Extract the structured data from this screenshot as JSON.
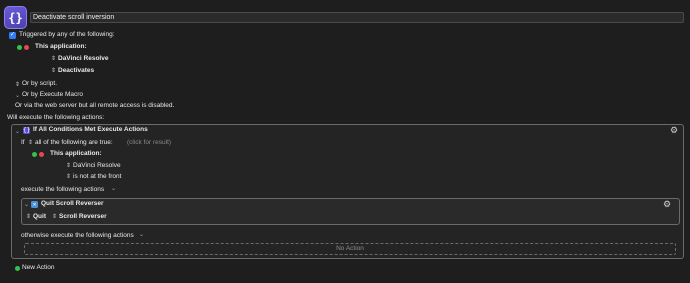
{
  "macro": {
    "name": "Deactivate scroll inversion"
  },
  "trigger": {
    "checkbox_label": "Triggered by any of the following:",
    "application_label": "This application:",
    "app_name": "DaVinci Resolve",
    "event": "Deactivates",
    "or_by_script": "Or by script.",
    "or_by_execute_macro": "Or by Execute Macro",
    "web_server_note": "Or via the web server but all remote access is disabled."
  },
  "actions": {
    "header": "Will execute the following actions:",
    "if_action": {
      "title": "If All Conditions Met Execute Actions",
      "if_word": "If",
      "condition_mode": "all of the following are true:",
      "click_hint": "(click for result)",
      "condition_label": "This application:",
      "condition_app": "DaVinci Resolve",
      "condition_state": "is not at the front",
      "then_label": "execute the following actions",
      "then_action": {
        "title": "Quit Scroll Reverser",
        "verb": "Quit",
        "target": "Scroll Reverser"
      },
      "else_label": "otherwise execute the following actions",
      "no_action": "No Action"
    },
    "new_action": "New Action"
  },
  "icons": {
    "macro": "curly-braces-icon",
    "gear": "gear-icon",
    "add": "plus-circle-icon",
    "remove": "minus-circle-icon",
    "stepper": "up-down-chevron-icon",
    "disclosure": "chevron-down-icon",
    "quit_app": "quit-app-icon"
  },
  "colors": {
    "background": "#1e1e1e",
    "accent_blue": "#2f7cf6",
    "add_green": "#35c24a",
    "remove_red": "#e5484d",
    "macro_purple": "#6a5cd8"
  }
}
